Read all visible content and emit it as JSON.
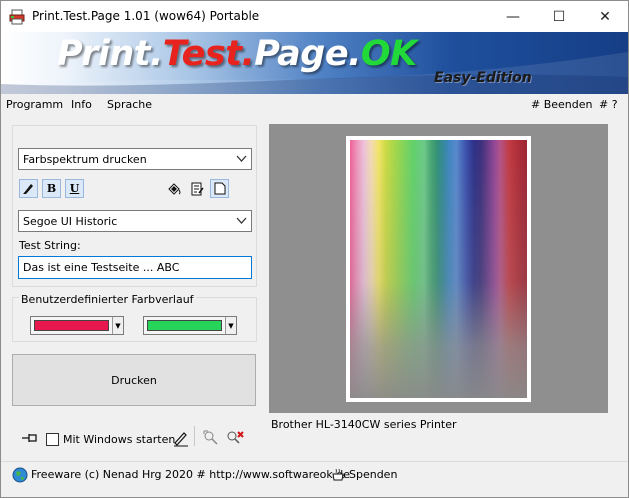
{
  "window": {
    "title": "Print.Test.Page 1.01  (wow64) Portable",
    "controls": {
      "minimize": "—",
      "maximize": "☐",
      "close": "✕"
    }
  },
  "banner": {
    "title_parts": [
      "Print.",
      "Test.",
      "Page.",
      "OK"
    ],
    "subtitle": "Easy-Edition"
  },
  "menu": {
    "items": [
      "Programm",
      "Info",
      "Sprache"
    ],
    "right_items": [
      "# Beenden",
      "# ?"
    ]
  },
  "controls": {
    "mode_select": "Farbspektrum drucken",
    "font_select": "Segoe UI Historic",
    "format_buttons": [
      "",
      "B",
      "U"
    ],
    "test_string_label": "Test String:",
    "test_string_value": "Das ist eine Testseite ... ABC",
    "gradient_label": "Benutzerdefinierter Farbverlauf",
    "gradient_color_1": "#e8174e",
    "gradient_color_2": "#27d45a",
    "print_button": "Drucken"
  },
  "bottom": {
    "pin_icon": "pin-icon",
    "start_with_windows": "Mit Windows starten",
    "start_with_windows_checked": false
  },
  "preview": {
    "printer_name": "Brother HL-3140CW series Printer"
  },
  "statusbar": {
    "left_text": "Freeware (c) Nenad Hrg 2020 # http://www.softwareok.de",
    "right_text": "Spenden"
  }
}
